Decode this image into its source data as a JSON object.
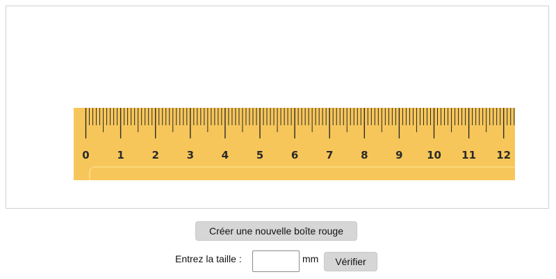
{
  "ruler": {
    "labels": [
      "0",
      "1",
      "2",
      "3",
      "4",
      "5",
      "6",
      "7",
      "8",
      "9",
      "10",
      "11",
      "12"
    ],
    "color": "#f7c65a",
    "tick_color": "#2a2a2a"
  },
  "controls": {
    "new_box_label": "Créer une nouvelle boîte rouge",
    "size_prompt": "Entrez la taille :",
    "size_value": "",
    "size_unit": "mm",
    "verify_label": "Vérifier"
  }
}
